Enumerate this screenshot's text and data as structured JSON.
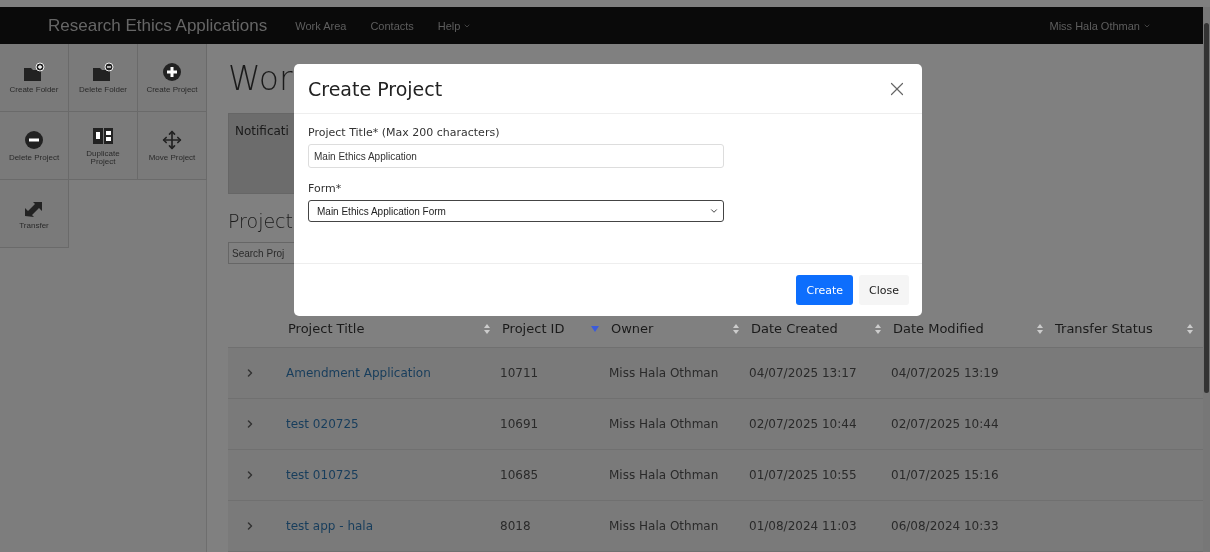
{
  "navbar": {
    "brand": "Research Ethics Applications",
    "links": [
      {
        "label": "Work Area",
        "dropdown": false
      },
      {
        "label": "Contacts",
        "dropdown": false
      },
      {
        "label": "Help",
        "dropdown": true
      }
    ],
    "user": "Miss Hala Othman"
  },
  "sidebar": {
    "tools": [
      {
        "label": "Create Folder",
        "kind": "folder-add"
      },
      {
        "label": "Delete Folder",
        "kind": "folder-remove"
      },
      {
        "label": "Create Project",
        "kind": "plus"
      },
      {
        "label": "Delete Project",
        "kind": "minus"
      },
      {
        "label": "Duplicate Project",
        "kind": "duplicate"
      },
      {
        "label": "Move Project",
        "kind": "move"
      },
      {
        "label": "Transfer",
        "kind": "transfer"
      }
    ]
  },
  "main": {
    "title": "Wor",
    "notifications_title": "Notificati",
    "projects_title": "Project",
    "search": {
      "placeholder": "Search Proj"
    }
  },
  "table": {
    "columns": [
      {
        "label": "Project Title",
        "sorted": false
      },
      {
        "label": "Project ID",
        "sorted": true
      },
      {
        "label": "Owner",
        "sorted": false
      },
      {
        "label": "Date Created",
        "sorted": false
      },
      {
        "label": "Date Modified",
        "sorted": false
      },
      {
        "label": "Transfer Status",
        "sorted": false
      }
    ],
    "rows": [
      {
        "title": "Amendment Application",
        "id": "10711",
        "owner": "Miss Hala Othman",
        "created": "04/07/2025 13:17",
        "modified": "04/07/2025 13:19"
      },
      {
        "title": "test 020725",
        "id": "10691",
        "owner": "Miss Hala Othman",
        "created": "02/07/2025 10:44",
        "modified": "02/07/2025 10:44"
      },
      {
        "title": "test 010725",
        "id": "10685",
        "owner": "Miss Hala Othman",
        "created": "01/07/2025 10:55",
        "modified": "01/07/2025 15:16"
      },
      {
        "title": "test app - hala",
        "id": "8018",
        "owner": "Miss Hala Othman",
        "created": "01/08/2024 11:03",
        "modified": "06/08/2024 10:33"
      }
    ]
  },
  "dialog": {
    "title": "Create Project",
    "title_label": "Project Title* (Max 200 characters)",
    "title_value": "Main Ethics Application",
    "form_label": "Form*",
    "form_value": "Main Ethics Application Form",
    "buttons": [
      {
        "label": "Create",
        "primary": true
      },
      {
        "label": "Close",
        "primary": false
      }
    ]
  }
}
